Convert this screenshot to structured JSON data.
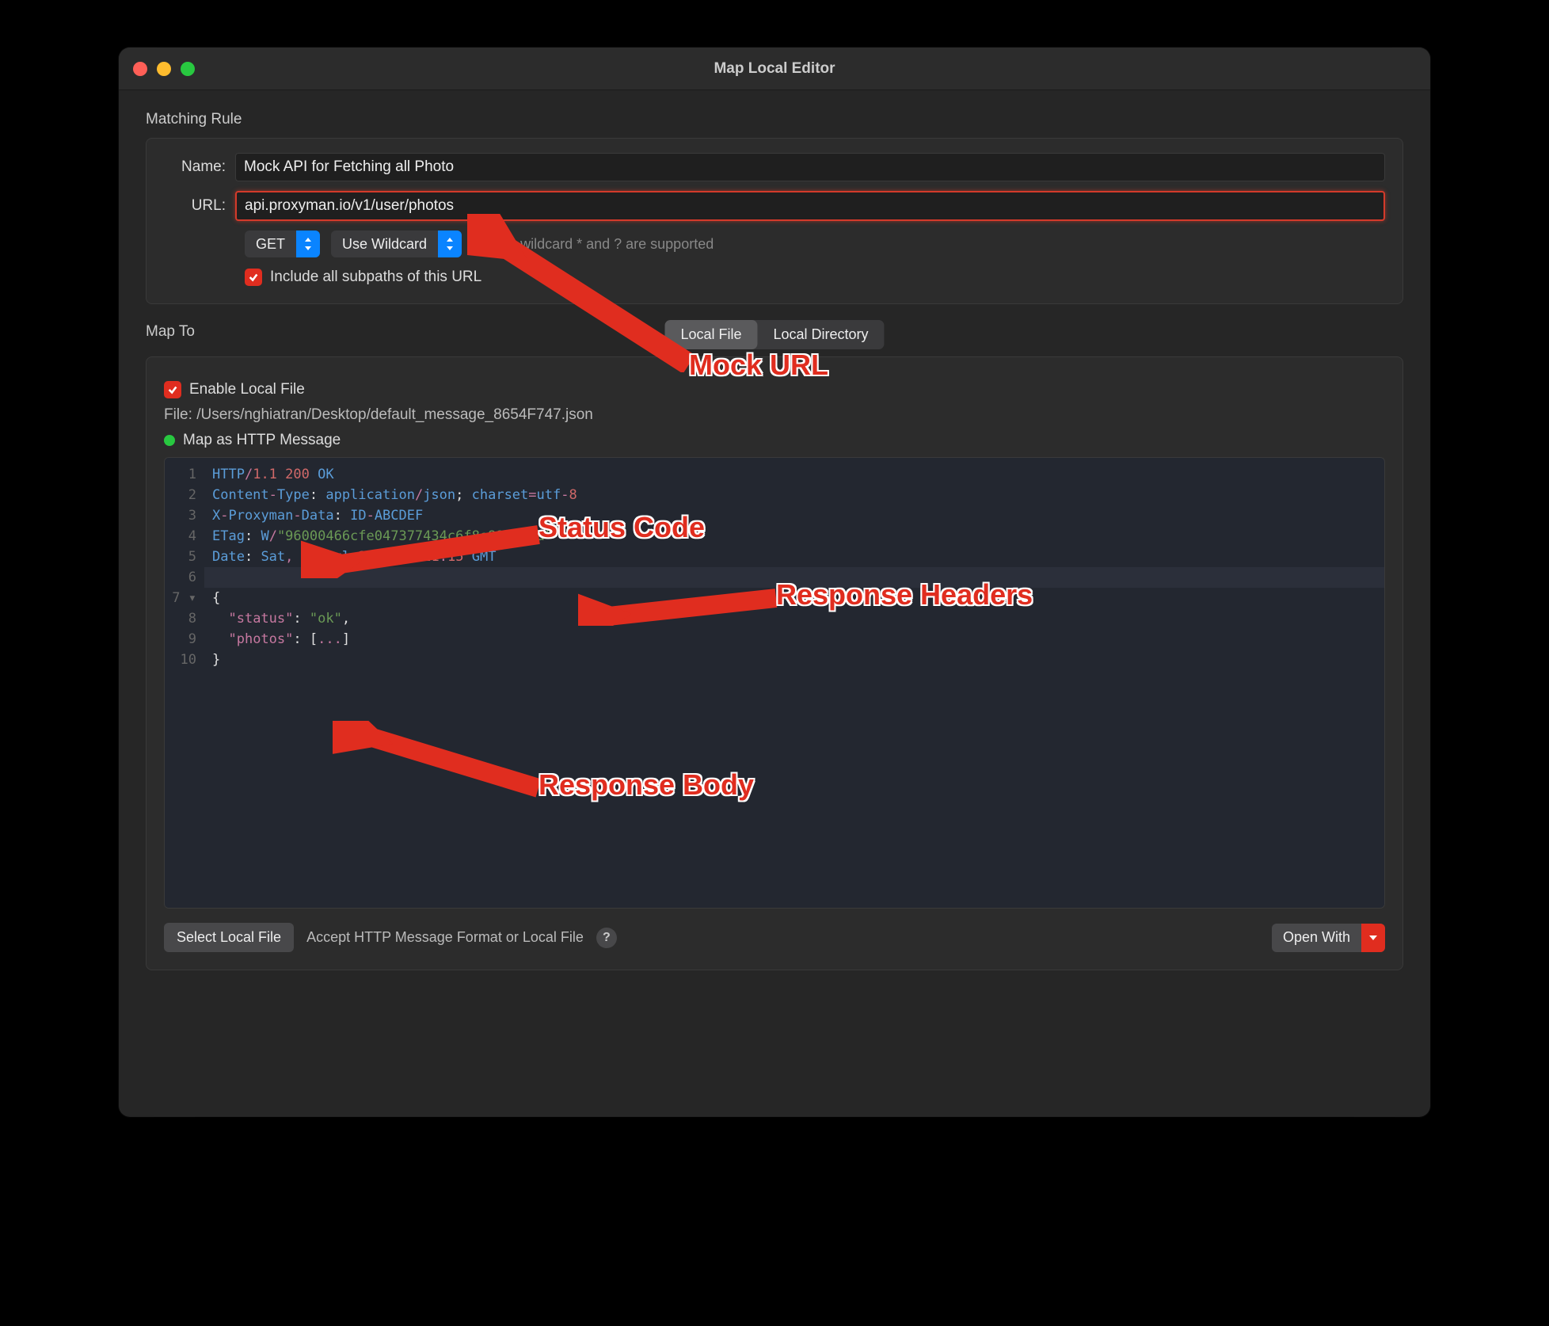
{
  "window": {
    "title": "Map Local Editor"
  },
  "matching_rule": {
    "section_label": "Matching Rule",
    "name_label": "Name:",
    "name_value": "Mock API for Fetching all Photo",
    "url_label": "URL:",
    "url_value": "api.proxyman.io/v1/user/photos",
    "method": "GET",
    "wildcard_label": "Use Wildcard",
    "wildcard_hint": "Simple wildcard * and ? are supported",
    "include_subpaths_label": "Include all subpaths of this URL",
    "include_subpaths_checked": true
  },
  "map_to": {
    "section_label": "Map To",
    "tabs": {
      "local_file": "Local File",
      "local_directory": "Local Directory",
      "active": "local_file"
    },
    "enable_local_file_label": "Enable Local File",
    "enable_local_file_checked": true,
    "file_label": "File:",
    "file_path": "/Users/nghiatran/Desktop/default_message_8654F747.json",
    "map_as_http_label": "Map as HTTP Message",
    "map_as_http_green": true,
    "code_lines": [
      {
        "n": 1,
        "tokens": [
          {
            "t": "HTTP",
            "c": "kw"
          },
          {
            "t": "/",
            "c": "punc"
          },
          {
            "t": "1.1",
            "c": "num"
          },
          {
            "t": " ",
            "c": "punc"
          },
          {
            "t": "200",
            "c": "num"
          },
          {
            "t": " ",
            "c": "punc"
          },
          {
            "t": "OK",
            "c": "kw"
          }
        ]
      },
      {
        "n": 2,
        "tokens": [
          {
            "t": "Content",
            "c": "kw"
          },
          {
            "t": "-",
            "c": "punc"
          },
          {
            "t": "Type",
            "c": "kw"
          },
          {
            "t": ": ",
            "c": "white"
          },
          {
            "t": "application",
            "c": "kw"
          },
          {
            "t": "/",
            "c": "punc"
          },
          {
            "t": "json",
            "c": "kw"
          },
          {
            "t": "; ",
            "c": "white"
          },
          {
            "t": "charset",
            "c": "kw"
          },
          {
            "t": "=",
            "c": "punc"
          },
          {
            "t": "utf",
            "c": "kw"
          },
          {
            "t": "-",
            "c": "punc"
          },
          {
            "t": "8",
            "c": "num"
          }
        ]
      },
      {
        "n": 3,
        "tokens": [
          {
            "t": "X",
            "c": "kw"
          },
          {
            "t": "-",
            "c": "punc"
          },
          {
            "t": "Proxyman",
            "c": "kw"
          },
          {
            "t": "-",
            "c": "punc"
          },
          {
            "t": "Data",
            "c": "kw"
          },
          {
            "t": ": ",
            "c": "white"
          },
          {
            "t": "ID",
            "c": "kw"
          },
          {
            "t": "-",
            "c": "punc"
          },
          {
            "t": "ABCDEF",
            "c": "kw"
          }
        ]
      },
      {
        "n": 4,
        "tokens": [
          {
            "t": "ETag",
            "c": "kw"
          },
          {
            "t": ": ",
            "c": "white"
          },
          {
            "t": "W",
            "c": "kw"
          },
          {
            "t": "/",
            "c": "punc"
          },
          {
            "t": "\"96000466cfe047377434c6f8e89528fa\"",
            "c": "str"
          }
        ]
      },
      {
        "n": 5,
        "tokens": [
          {
            "t": "Date",
            "c": "kw"
          },
          {
            "t": ": ",
            "c": "white"
          },
          {
            "t": "Sat",
            "c": "kw"
          },
          {
            "t": ", ",
            "c": "punc"
          },
          {
            "t": "03",
            "c": "num"
          },
          {
            "t": " ",
            "c": "white"
          },
          {
            "t": "Jul",
            "c": "kw"
          },
          {
            "t": " ",
            "c": "white"
          },
          {
            "t": "2021",
            "c": "num"
          },
          {
            "t": " ",
            "c": "white"
          },
          {
            "t": "02",
            "c": "num"
          },
          {
            "t": ":",
            "c": "punc"
          },
          {
            "t": "21",
            "c": "num"
          },
          {
            "t": ":",
            "c": "punc"
          },
          {
            "t": "15",
            "c": "num"
          },
          {
            "t": " ",
            "c": "white"
          },
          {
            "t": "GMT",
            "c": "kw"
          }
        ]
      },
      {
        "n": 6,
        "hl": true,
        "tokens": []
      },
      {
        "n": "7 ▾",
        "tokens": [
          {
            "t": "{",
            "c": "white"
          }
        ]
      },
      {
        "n": 8,
        "tokens": [
          {
            "t": "  ",
            "c": "white"
          },
          {
            "t": "\"status\"",
            "c": "prop"
          },
          {
            "t": ": ",
            "c": "white"
          },
          {
            "t": "\"ok\"",
            "c": "str"
          },
          {
            "t": ",",
            "c": "white"
          }
        ]
      },
      {
        "n": 9,
        "tokens": [
          {
            "t": "  ",
            "c": "white"
          },
          {
            "t": "\"photos\"",
            "c": "prop"
          },
          {
            "t": ": ",
            "c": "white"
          },
          {
            "t": "[",
            "c": "white"
          },
          {
            "t": "...",
            "c": "punc"
          },
          {
            "t": "]",
            "c": "white"
          }
        ]
      },
      {
        "n": 10,
        "tokens": [
          {
            "t": "}",
            "c": "white"
          }
        ]
      }
    ],
    "select_local_file_label": "Select Local File",
    "accept_format_label": "Accept HTTP Message Format or Local File",
    "open_with_label": "Open With"
  },
  "annotations": {
    "mock_url": "Mock URL",
    "status_code": "Status Code",
    "response_headers": "Response Headers",
    "response_body": "Response Body"
  }
}
